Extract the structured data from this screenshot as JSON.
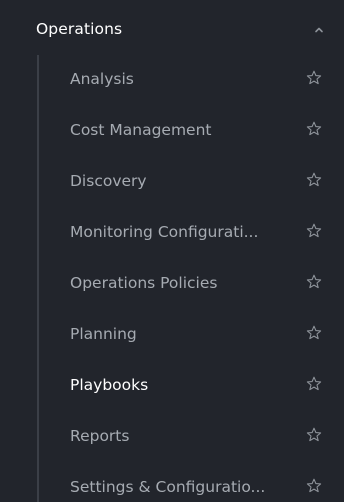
{
  "colors": {
    "background": "#22252c",
    "text_default": "#a6abb2",
    "text_active": "#ffffff",
    "tree_line": "#3b3f47",
    "icon": "#8d9299"
  },
  "section": {
    "title": "Operations",
    "expanded": true,
    "toggle_icon": "chevron-up-icon"
  },
  "items": [
    {
      "label": "Analysis",
      "icon": "star-outline-icon",
      "active": false
    },
    {
      "label": "Cost Management",
      "icon": "star-outline-icon",
      "active": false
    },
    {
      "label": "Discovery",
      "icon": "star-outline-icon",
      "active": false
    },
    {
      "label": "Monitoring Configurati...",
      "icon": "star-outline-icon",
      "active": false
    },
    {
      "label": "Operations Policies",
      "icon": "star-outline-icon",
      "active": false
    },
    {
      "label": "Planning",
      "icon": "star-outline-icon",
      "active": false
    },
    {
      "label": "Playbooks",
      "icon": "star-outline-icon",
      "active": true
    },
    {
      "label": "Reports",
      "icon": "star-outline-icon",
      "active": false
    },
    {
      "label": "Settings & Configuratio...",
      "icon": "star-outline-icon",
      "active": false
    }
  ]
}
